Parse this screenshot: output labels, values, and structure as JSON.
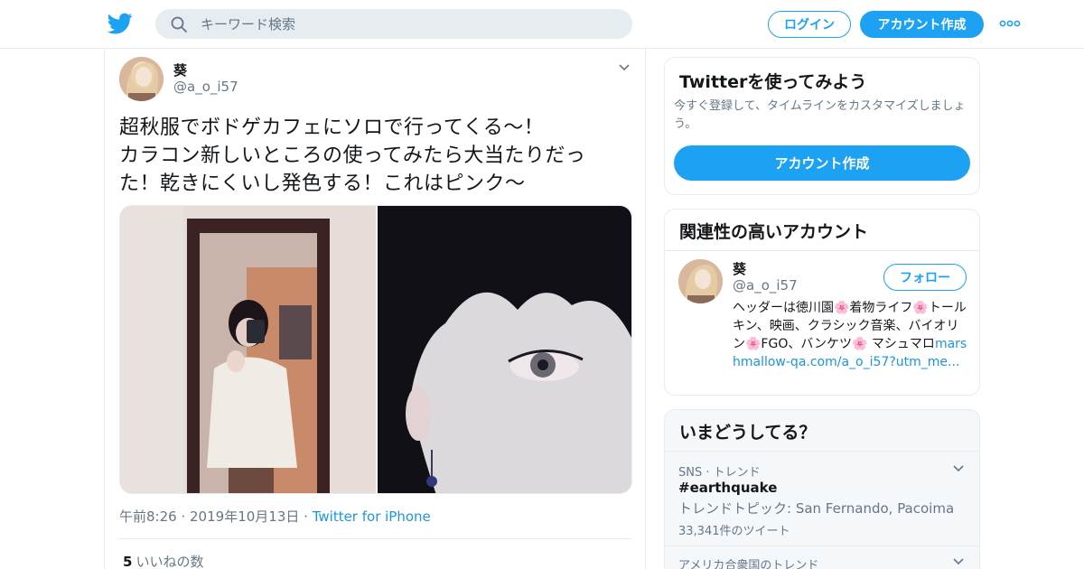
{
  "header": {
    "search_placeholder": "キーワード検索",
    "login_label": "ログイン",
    "signup_label": "アカウント作成"
  },
  "tweet": {
    "author_name": "葵",
    "author_handle": "@a_o_i57",
    "text_lines": [
      "超秋服でボドゲカフェにソロで行ってくる〜！",
      "カラコン新しいところの使ってみたら大当たりだっ",
      "た！乾きにくいし発色する！これはピンク〜"
    ],
    "time": "午前8:26",
    "date": "2019年10月13日",
    "source": "Twitter for iPhone",
    "like_count": "5",
    "like_label": "いいねの数"
  },
  "signup_card": {
    "title": "Twitterを使ってみよう",
    "description": "今すぐ登録して、タイムラインをカスタマイズしましょう。",
    "cta_label": "アカウント作成"
  },
  "related_card": {
    "title": "関連性の高いアカウント",
    "name": "葵",
    "handle": "@a_o_i57",
    "follow_label": "フォロー",
    "bio_text": "ヘッダーは徳川園🌸着物ライフ🌸トールキン、映画、クラシック音楽、バイオリン🌸FGO、バンケツ🌸 マシュマロ",
    "bio_link": "marshmallow-qa.com/a_o_i57?utm_me..."
  },
  "trends_card": {
    "title": "いまどうしてる？",
    "trends": [
      {
        "context": "SNS · トレンド",
        "name": "#earthquake",
        "topic": "トレンドトピック: San Fernando, Pacoima",
        "count": "33,341件のツイート"
      },
      {
        "context": "アメリカ合衆国のトレンド"
      }
    ]
  },
  "colors": {
    "accent": "#1da1f2",
    "link": "#1b95e0",
    "muted": "#657786",
    "border": "#e6ecf0"
  }
}
